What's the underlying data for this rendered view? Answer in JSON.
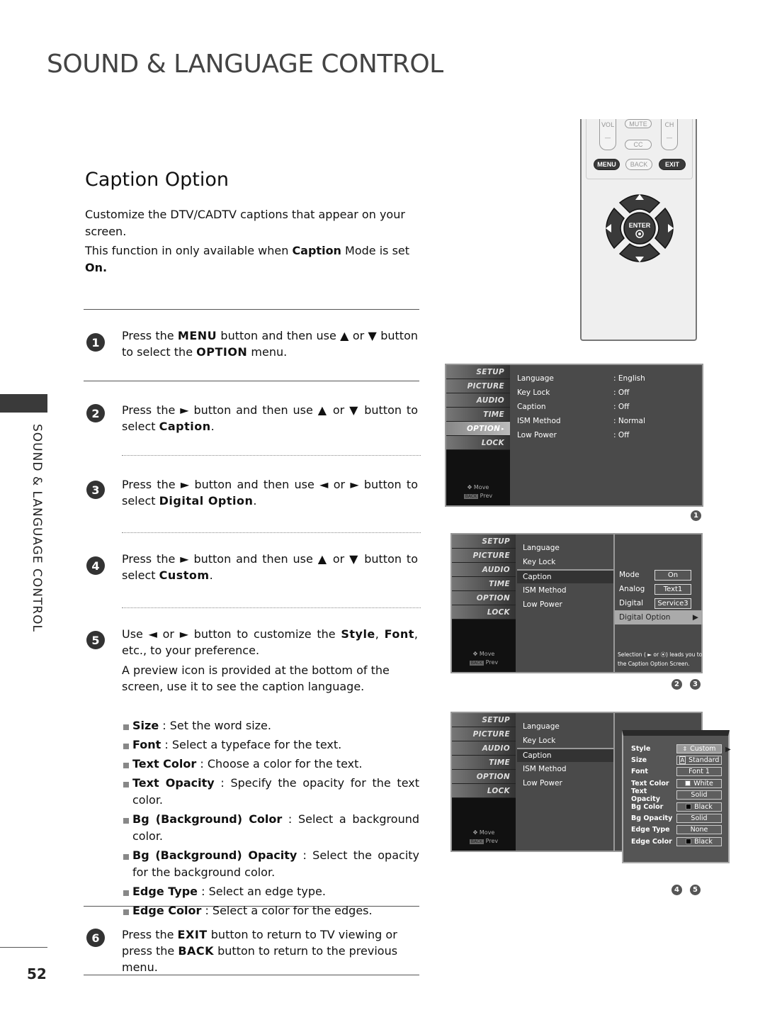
{
  "header": {
    "title": "SOUND & LANGUAGE CONTROL"
  },
  "side_tab": {
    "label": "SOUND & LANGUAGE CONTROL"
  },
  "page_number": "52",
  "section": {
    "title": "Caption Option",
    "intro_1": "Customize the DTV/CADTV captions that appear on your screen.",
    "intro_2_pre": "This function in only available when ",
    "intro_2_bold": "Caption",
    "intro_2_post": " Mode is set",
    "intro_2_end": "On."
  },
  "steps": [
    {
      "num": "1",
      "parts": [
        "Press the ",
        "MENU",
        " button and then use ▲ or ▼ button to select the ",
        "OPTION",
        " menu."
      ]
    },
    {
      "num": "2",
      "parts": [
        "Press the ► button and then use ▲ or ▼ button to select ",
        "Caption",
        "."
      ]
    },
    {
      "num": "3",
      "parts": [
        "Press the ► button and then use ◄ or ► button to select ",
        "Digital Option",
        "."
      ]
    },
    {
      "num": "4",
      "parts": [
        "Press the ► button and then use ▲ or ▼ button to select ",
        "Custom",
        "."
      ]
    },
    {
      "num": "5",
      "parts": [
        "Use ◄ or ► button to customize the ",
        "Style",
        ", ",
        "Font",
        ", etc., to your preference."
      ],
      "extra": "A preview icon is provided at the bottom of the screen, use it to see the caption language."
    },
    {
      "num": "6",
      "parts": [
        "Press the ",
        "EXIT",
        " button to return to TV viewing or press the ",
        "BACK",
        " button to return to the previous menu."
      ]
    }
  ],
  "bullets": [
    {
      "term": "Size",
      "desc": " : Set the word size."
    },
    {
      "term": "Font",
      "desc": " : Select a typeface for the text."
    },
    {
      "term": "Text Color",
      "desc": " : Choose a color for the text."
    },
    {
      "term": "Text Opacity",
      "desc": " : Specify the opacity for the text color."
    },
    {
      "term": "Bg (Background) Color",
      "desc": " : Select a background color."
    },
    {
      "term": "Bg (Background) Opacity",
      "desc": " : Select the opacity for the background color."
    },
    {
      "term": "Edge Type",
      "desc": " : Select an edge type."
    },
    {
      "term": "Edge Color",
      "desc": " : Select a color for the edges."
    }
  ],
  "remote": {
    "vol": "VOL",
    "mute": "MUTE",
    "ch": "CH",
    "cc": "CC",
    "menu": "MENU",
    "back": "BACK",
    "exit": "EXIT",
    "enter": "ENTER"
  },
  "osd": {
    "side_menu": [
      "SETUP",
      "PICTURE",
      "AUDIO",
      "TIME",
      "OPTION",
      "LOCK"
    ],
    "footer_move": "Move",
    "footer_prev": "Prev",
    "footer_back_key": "BACK",
    "screen1": {
      "rows": [
        {
          "label": "Language",
          "value": ": English"
        },
        {
          "label": "Key Lock",
          "value": ": Off"
        },
        {
          "label": "Caption",
          "value": ": Off"
        },
        {
          "label": "ISM Method",
          "value": ": Normal"
        },
        {
          "label": "Low Power",
          "value": ": Off"
        }
      ],
      "ref": "1"
    },
    "screen2": {
      "rows": [
        "Language",
        "Key Lock",
        "Caption",
        "ISM Method",
        "Low Power"
      ],
      "sub": [
        {
          "label": "Mode",
          "value": "On"
        },
        {
          "label": "Analog",
          "value": "Text1"
        },
        {
          "label": "Digital",
          "value": "Service3"
        }
      ],
      "digital_option": "Digital Option",
      "hint": "Selection ( ► or ⦿) leads you to the Caption Option Screen.",
      "refs": [
        "2",
        "3"
      ]
    },
    "screen3": {
      "rows": [
        "Language",
        "Key Lock",
        "Caption",
        "ISM Method",
        "Low Power"
      ],
      "options": [
        {
          "label": "Style",
          "value": "Custom"
        },
        {
          "label": "Size",
          "value": "Standard"
        },
        {
          "label": "Font",
          "value": "Font  1"
        },
        {
          "label": "Text Color",
          "value": "White",
          "swatch": "#ffffff"
        },
        {
          "label": "Text Opacity",
          "value": "Solid"
        },
        {
          "label": "Bg Color",
          "value": "Black",
          "swatch": "#000000"
        },
        {
          "label": "Bg Opacity",
          "value": "Solid"
        },
        {
          "label": "Edge Type",
          "value": "None"
        },
        {
          "label": "Edge Color",
          "value": "Black",
          "swatch": "#000000"
        }
      ],
      "refs": [
        "4",
        "5"
      ]
    }
  }
}
